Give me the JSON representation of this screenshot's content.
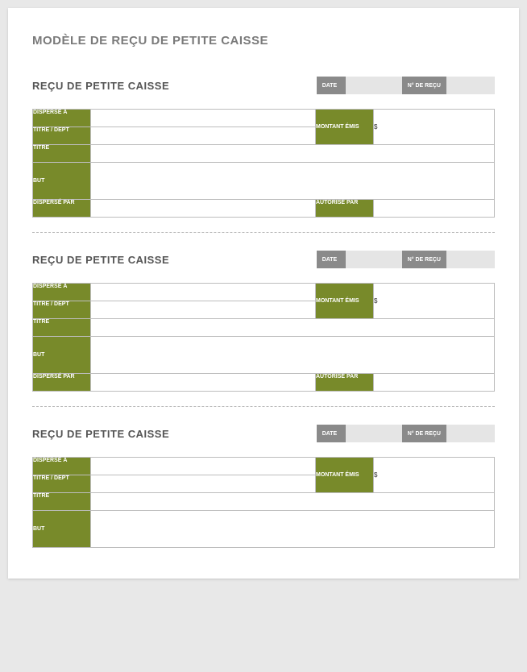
{
  "pageTitle": "MODÈLE DE REÇU DE PETITE CAISSE",
  "receipts": [
    {
      "heading": "REÇU DE PETITE CAISSE",
      "dateLabel": "DATE",
      "dateValue": "",
      "receiptNoLabel": "N° DE REÇU",
      "receiptNoValue": "",
      "dispersedToLabel": "DISPERSÉ À",
      "dispersedToValue": "",
      "titleDeptLabel": "TITRE / DEPT",
      "titleDeptValue": "",
      "titleLabel": "TITRE",
      "titleValue": "",
      "purposeLabel": "BUT",
      "purposeValue": "",
      "dispersedByLabel": "DISPERSÉ PAR",
      "dispersedByValue": "",
      "authorizedByLabel": "AUTORISÉ PAR",
      "authorizedByValue": "",
      "amountLabel": "MONTANT ÉMIS",
      "amountValue": "$"
    },
    {
      "heading": "REÇU DE PETITE CAISSE",
      "dateLabel": "DATE",
      "dateValue": "",
      "receiptNoLabel": "N° DE REÇU",
      "receiptNoValue": "",
      "dispersedToLabel": "DISPERSÉ À",
      "dispersedToValue": "",
      "titleDeptLabel": "TITRE / DEPT",
      "titleDeptValue": "",
      "titleLabel": "TITRE",
      "titleValue": "",
      "purposeLabel": "BUT",
      "purposeValue": "",
      "dispersedByLabel": "DISPERSÉ PAR",
      "dispersedByValue": "",
      "authorizedByLabel": "AUTORISÉ PAR",
      "authorizedByValue": "",
      "amountLabel": "MONTANT ÉMIS",
      "amountValue": "$"
    },
    {
      "heading": "REÇU DE PETITE CAISSE",
      "dateLabel": "DATE",
      "dateValue": "",
      "receiptNoLabel": "N° DE REÇU",
      "receiptNoValue": "",
      "dispersedToLabel": "DISPERSÉ À",
      "dispersedToValue": "",
      "titleDeptLabel": "TITRE / DEPT",
      "titleDeptValue": "",
      "titleLabel": "TITRE",
      "titleValue": "",
      "purposeLabel": "BUT",
      "purposeValue": "",
      "amountLabel": "MONTANT ÉMIS",
      "amountValue": "$"
    }
  ]
}
